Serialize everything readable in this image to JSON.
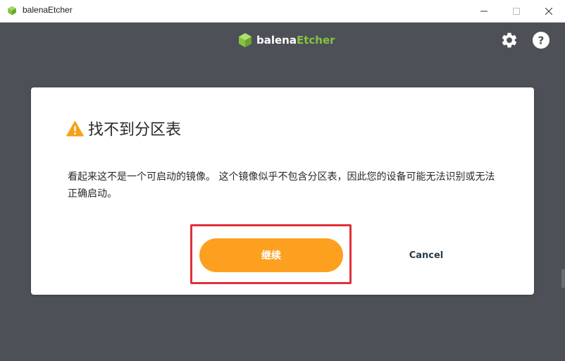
{
  "window": {
    "title": "balenaEtcher",
    "controls": {
      "minimize": "minimize",
      "maximize": "maximize",
      "close": "close"
    }
  },
  "header": {
    "logo": {
      "part1": "balena",
      "part2": "Etcher"
    },
    "icons": {
      "settings": "gear-icon",
      "help": "help-circle-icon"
    }
  },
  "dialog": {
    "title": "找不到分区表",
    "message": "看起来这不是一个可启动的镜像。 这个镜像似乎不包含分区表，因此您的设备可能无法识别或无法正确启动。",
    "buttons": {
      "continue": "继续",
      "cancel": "Cancel"
    },
    "icon": "warning-icon"
  },
  "colors": {
    "background": "#4d5057",
    "accent": "#fda01f",
    "brand_green": "#85c441",
    "highlight": "#e0303a",
    "warning": "#f6a11a"
  }
}
